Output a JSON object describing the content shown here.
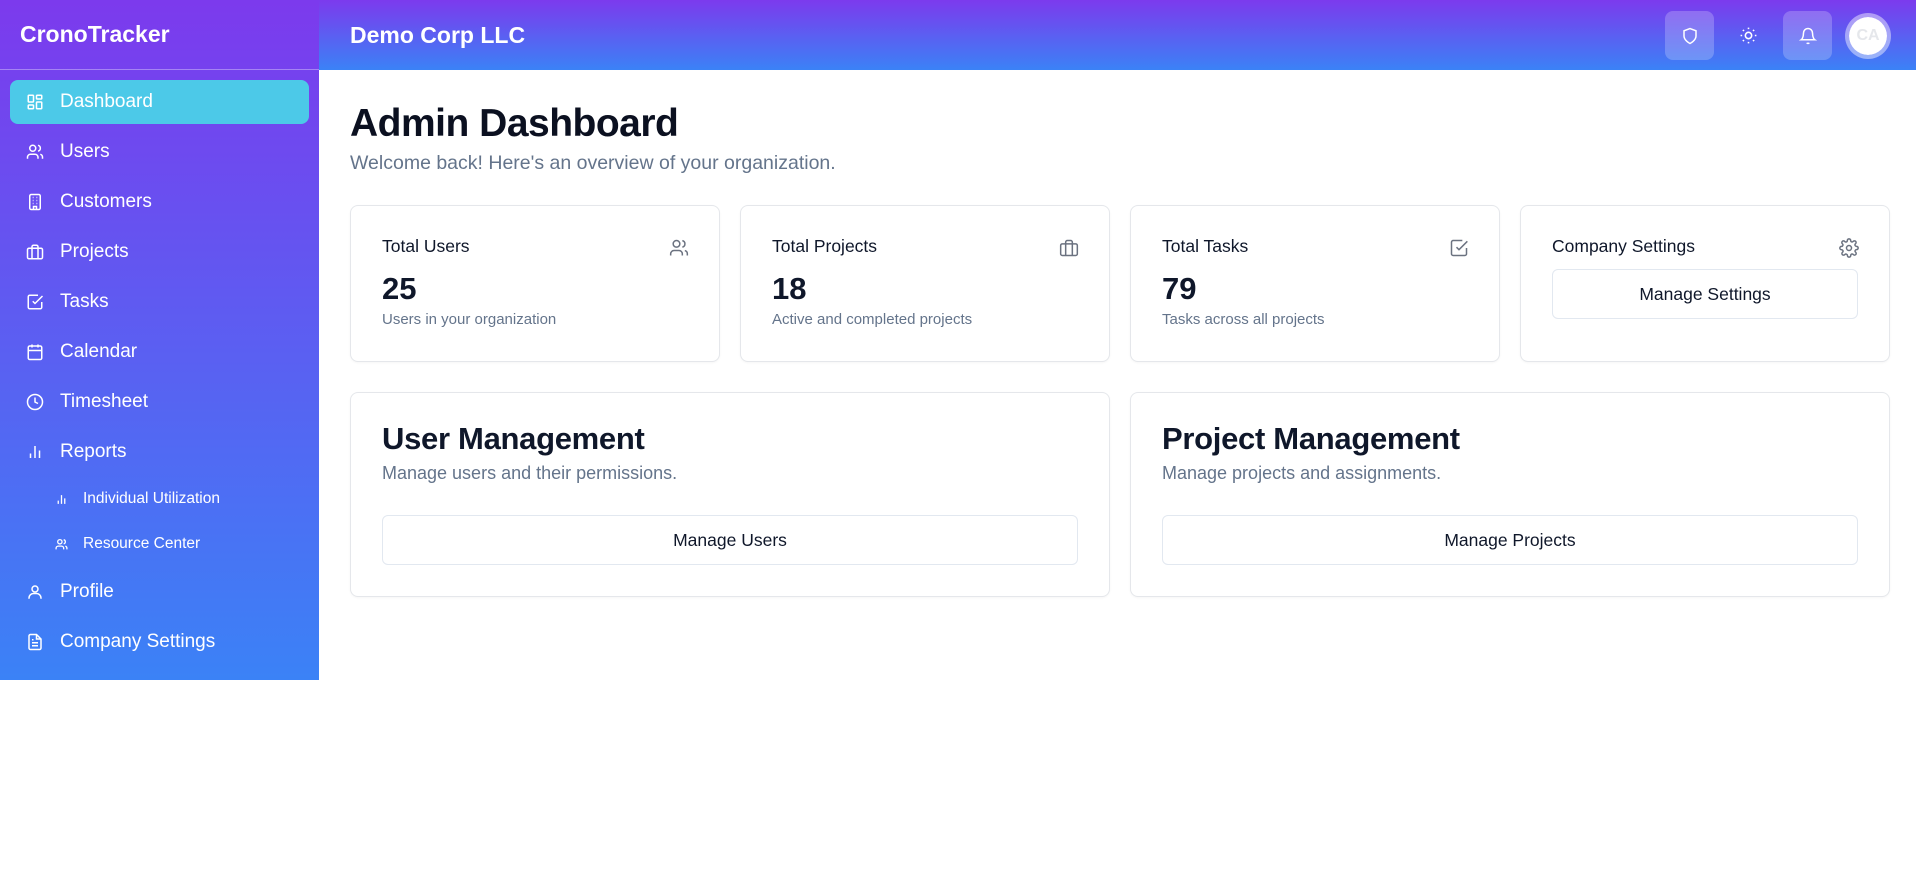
{
  "app": {
    "title": "CronoTracker"
  },
  "header": {
    "company": "Demo Corp LLC",
    "avatar_initials": "CA"
  },
  "sidebar": {
    "items": [
      {
        "label": "Dashboard",
        "icon": "dashboard-icon",
        "active": true
      },
      {
        "label": "Users",
        "icon": "users-icon"
      },
      {
        "label": "Customers",
        "icon": "building-icon"
      },
      {
        "label": "Projects",
        "icon": "briefcase-icon"
      },
      {
        "label": "Tasks",
        "icon": "check-square-icon"
      },
      {
        "label": "Calendar",
        "icon": "calendar-icon"
      },
      {
        "label": "Timesheet",
        "icon": "clock-icon"
      },
      {
        "label": "Reports",
        "icon": "bar-chart-icon"
      },
      {
        "label": "Individual Utilization",
        "icon": "bar-chart-icon",
        "sub": true
      },
      {
        "label": "Resource Center",
        "icon": "users-icon",
        "sub": true
      },
      {
        "label": "Profile",
        "icon": "user-icon"
      },
      {
        "label": "Company Settings",
        "icon": "document-icon"
      }
    ]
  },
  "main": {
    "title": "Admin Dashboard",
    "subtitle": "Welcome back! Here's an overview of your organization.",
    "stats": [
      {
        "title": "Total Users",
        "value": "25",
        "desc": "Users in your organization",
        "icon": "users-icon"
      },
      {
        "title": "Total Projects",
        "value": "18",
        "desc": "Active and completed projects",
        "icon": "briefcase-icon"
      },
      {
        "title": "Total Tasks",
        "value": "79",
        "desc": "Tasks across all projects",
        "icon": "check-square-icon"
      }
    ],
    "settings_card": {
      "title": "Company Settings",
      "button": "Manage Settings",
      "icon": "gear-icon"
    },
    "management": [
      {
        "title": "User Management",
        "desc": "Manage users and their permissions.",
        "button": "Manage Users"
      },
      {
        "title": "Project Management",
        "desc": "Manage projects and assignments.",
        "button": "Manage Projects"
      }
    ]
  },
  "colors": {
    "accent": "#4cc9e8",
    "gradient_start": "#7c3aed",
    "gradient_end": "#3b82f6"
  }
}
